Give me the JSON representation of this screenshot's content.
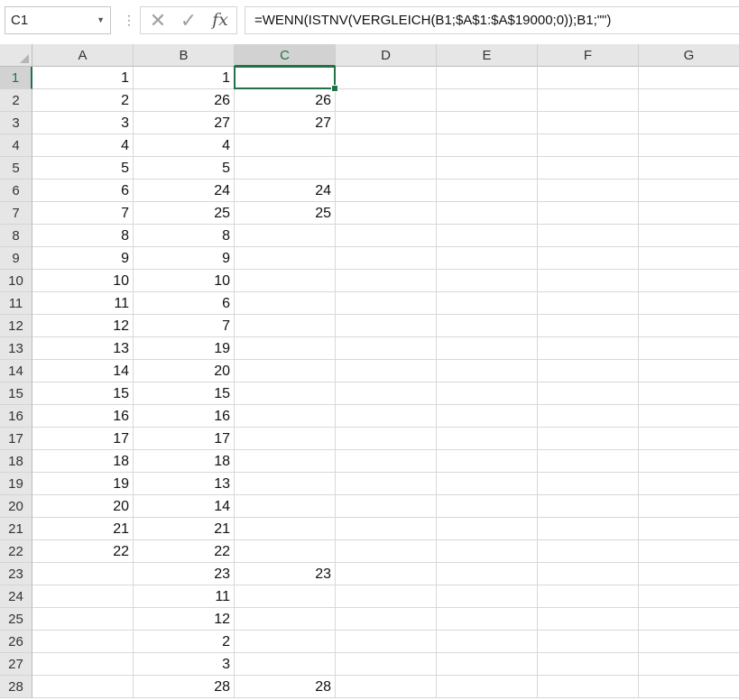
{
  "namebox": {
    "value": "C1"
  },
  "formula_bar": {
    "cancel_icon": "cross-icon",
    "enter_icon": "check-icon",
    "fx_label": "fx",
    "formula": "=WENN(ISTNV(VERGLEICH(B1;$A$1:$A$19000;0));B1;\"\")"
  },
  "sheet": {
    "columns": [
      "A",
      "B",
      "C",
      "D",
      "E",
      "F",
      "G"
    ],
    "selected_column": "C",
    "selected_row": 1,
    "active_cell": "C1",
    "accent_color": "#217346",
    "rows": [
      {
        "n": "1",
        "A": "1",
        "B": "1",
        "C": ""
      },
      {
        "n": "2",
        "A": "2",
        "B": "26",
        "C": "26"
      },
      {
        "n": "3",
        "A": "3",
        "B": "27",
        "C": "27"
      },
      {
        "n": "4",
        "A": "4",
        "B": "4",
        "C": ""
      },
      {
        "n": "5",
        "A": "5",
        "B": "5",
        "C": ""
      },
      {
        "n": "6",
        "A": "6",
        "B": "24",
        "C": "24"
      },
      {
        "n": "7",
        "A": "7",
        "B": "25",
        "C": "25"
      },
      {
        "n": "8",
        "A": "8",
        "B": "8",
        "C": ""
      },
      {
        "n": "9",
        "A": "9",
        "B": "9",
        "C": ""
      },
      {
        "n": "10",
        "A": "10",
        "B": "10",
        "C": ""
      },
      {
        "n": "11",
        "A": "11",
        "B": "6",
        "C": ""
      },
      {
        "n": "12",
        "A": "12",
        "B": "7",
        "C": ""
      },
      {
        "n": "13",
        "A": "13",
        "B": "19",
        "C": ""
      },
      {
        "n": "14",
        "A": "14",
        "B": "20",
        "C": ""
      },
      {
        "n": "15",
        "A": "15",
        "B": "15",
        "C": ""
      },
      {
        "n": "16",
        "A": "16",
        "B": "16",
        "C": ""
      },
      {
        "n": "17",
        "A": "17",
        "B": "17",
        "C": ""
      },
      {
        "n": "18",
        "A": "18",
        "B": "18",
        "C": ""
      },
      {
        "n": "19",
        "A": "19",
        "B": "13",
        "C": ""
      },
      {
        "n": "20",
        "A": "20",
        "B": "14",
        "C": ""
      },
      {
        "n": "21",
        "A": "21",
        "B": "21",
        "C": ""
      },
      {
        "n": "22",
        "A": "22",
        "B": "22",
        "C": ""
      },
      {
        "n": "23",
        "A": "",
        "B": "23",
        "C": "23"
      },
      {
        "n": "24",
        "A": "",
        "B": "11",
        "C": ""
      },
      {
        "n": "25",
        "A": "",
        "B": "12",
        "C": ""
      },
      {
        "n": "26",
        "A": "",
        "B": "2",
        "C": ""
      },
      {
        "n": "27",
        "A": "",
        "B": "3",
        "C": ""
      },
      {
        "n": "28",
        "A": "",
        "B": "28",
        "C": "28"
      }
    ]
  }
}
